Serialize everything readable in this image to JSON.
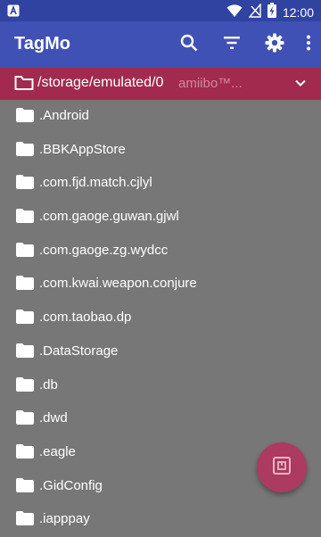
{
  "status_bar": {
    "time": "12:00",
    "left_icon": "a-notification-icon",
    "icons": [
      "wifi-icon",
      "signal-icon",
      "battery-charging-icon"
    ]
  },
  "app_bar": {
    "title": "TagMo",
    "actions": [
      "search-icon",
      "filter-icon",
      "settings-icon",
      "overflow-menu-icon"
    ]
  },
  "path_bar": {
    "path": "/storage/emulated/0",
    "ghost_text": "amiibo™..."
  },
  "files": [
    {
      "label": ".Android"
    },
    {
      "label": ".BBKAppStore"
    },
    {
      "label": ".com.fjd.match.cjlyl"
    },
    {
      "label": ".com.gaoge.guwan.gjwl"
    },
    {
      "label": ".com.gaoge.zg.wydcc"
    },
    {
      "label": ".com.kwai.weapon.conjure"
    },
    {
      "label": ".com.taobao.dp"
    },
    {
      "label": ".DataStorage"
    },
    {
      "label": ".db"
    },
    {
      "label": ".dwd"
    },
    {
      "label": ".eagle"
    },
    {
      "label": ".GidConfig"
    },
    {
      "label": ".iapppay"
    }
  ],
  "fab": {
    "icon": "nfc-scan-icon"
  },
  "colors": {
    "status_bar": "#3043a0",
    "app_bar": "#3f51b5",
    "path_bar": "#a22a4e",
    "list_background": "#777777",
    "fab": "#ad3a60"
  }
}
